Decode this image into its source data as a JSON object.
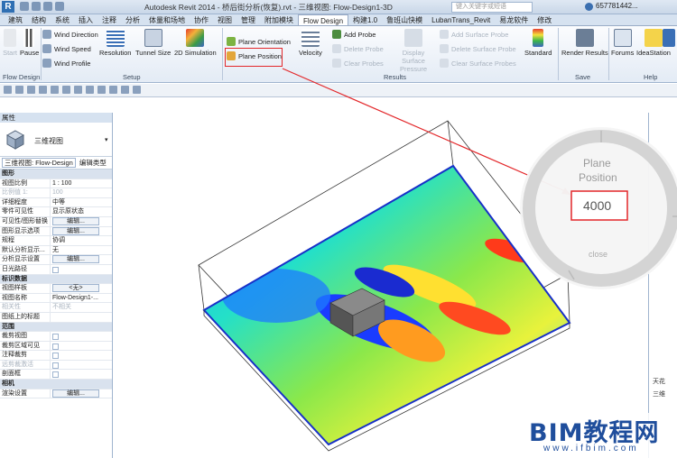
{
  "app": {
    "logo_letter": "R",
    "title": "Autodesk Revit 2014 -    桥后街分析(恢复).rvt - 三维视图: Flow-Design1-3D",
    "search_placeholder": "键入关键字或短语",
    "user": "657781442..."
  },
  "tabs": [
    {
      "label": "建筑"
    },
    {
      "label": "结构"
    },
    {
      "label": "系统"
    },
    {
      "label": "插入"
    },
    {
      "label": "注释"
    },
    {
      "label": "分析"
    },
    {
      "label": "体量和场地"
    },
    {
      "label": "协作"
    },
    {
      "label": "视图"
    },
    {
      "label": "管理"
    },
    {
      "label": "附加模块"
    },
    {
      "label": "Flow Design"
    },
    {
      "label": "构建1.0"
    },
    {
      "label": "鲁班山快模"
    },
    {
      "label": "LubanTrans_Revit"
    },
    {
      "label": "易龙软件"
    },
    {
      "label": "修改"
    }
  ],
  "active_tab": "Flow Design",
  "ribbon": {
    "start": "Start",
    "pause": "Pause",
    "wind_direction": "Wind Direction",
    "wind_speed": "Wind Speed",
    "wind_profile": "Wind Profile",
    "resolution": "Resolution",
    "tunnel_size": "Tunnel Size",
    "simulation_2d": "2D Simulation",
    "plane_orientation": "Plane Orientation",
    "plane_position": "Plane Position",
    "velocity": "Velocity",
    "add_probe": "Add Probe",
    "delete_probe": "Delete Probe",
    "clear_probes": "Clear Probes",
    "display_surface_pressure": "Display Surface Pressure",
    "add_surface_probe": "Add Surface Probe",
    "delete_surface_probe": "Delete Surface Probe",
    "clear_surface_probes": "Clear Surface Probes",
    "standard": "Standard",
    "render_results": "Render Results",
    "forums": "Forums",
    "ideastation": "IdeaStation",
    "help": "Help",
    "groups": {
      "flow_design": "Flow Design",
      "setup": "Setup",
      "results": "Results",
      "save": "Save",
      "help": "Help"
    }
  },
  "properties": {
    "header": "属性",
    "type_name": "三维视图",
    "selector": "三维视图: Flow-Design",
    "edit_type": "编辑类型",
    "rows": [
      {
        "k": "图形",
        "v": "",
        "cat": true
      },
      {
        "k": "视图比例",
        "v": "1 : 100",
        "input": true
      },
      {
        "k": "比例值 1:",
        "v": "100",
        "dim": true
      },
      {
        "k": "详细程度",
        "v": "中等"
      },
      {
        "k": "零件可见性",
        "v": "显示原状态"
      },
      {
        "k": "可见性/图形替换",
        "v": "编辑...",
        "btn": true
      },
      {
        "k": "图形显示选项",
        "v": "编辑...",
        "btn": true
      },
      {
        "k": "规程",
        "v": "协调"
      },
      {
        "k": "默认分析显示...",
        "v": "无"
      },
      {
        "k": "分析显示设置",
        "v": "编辑...",
        "btn": true
      },
      {
        "k": "日光路径",
        "v": "",
        "chk": true
      },
      {
        "k": "标识数据",
        "v": "",
        "cat": true
      },
      {
        "k": "视图样板",
        "v": "<无>",
        "btn": true
      },
      {
        "k": "视图名称",
        "v": "Flow-Design1-..."
      },
      {
        "k": "相关性",
        "v": "不相关",
        "dim": true
      },
      {
        "k": "图纸上的标题",
        "v": ""
      },
      {
        "k": "范围",
        "v": "",
        "cat": true
      },
      {
        "k": "裁剪视图",
        "v": "",
        "chk": true
      },
      {
        "k": "裁剪区域可见",
        "v": "",
        "chk": true
      },
      {
        "k": "注释裁剪",
        "v": "",
        "chk": true
      },
      {
        "k": "远剪裁激活",
        "v": "",
        "chk": true,
        "dim": true
      },
      {
        "k": "剖面框",
        "v": "",
        "chk": true
      },
      {
        "k": "相机",
        "v": "",
        "cat": true
      },
      {
        "k": "渲染设置",
        "v": "编辑...",
        "btn": true
      }
    ]
  },
  "popup": {
    "title_line1": "Plane",
    "title_line2": "Position",
    "value": "4000",
    "close": "close"
  },
  "browser_items": [
    "天花",
    "三维"
  ],
  "watermark": {
    "line1": "BIM教程网",
    "line2": "www.ifbim.com"
  },
  "colors": {
    "accent_red": "#e3272a",
    "ribbon_bg": "#e3ebf5",
    "watermark_blue": "#1f4e9c"
  }
}
